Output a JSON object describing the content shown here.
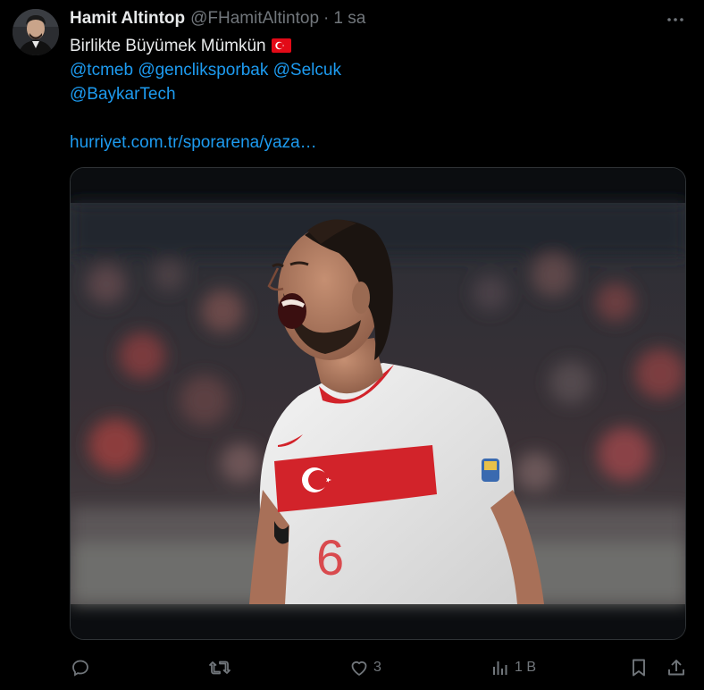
{
  "tweet": {
    "author_name": "Hamit Altintop",
    "handle": "@FHamitAltintop",
    "separator": "·",
    "time": "1 sa",
    "text_line1": "Birlikte Büyümek Mümkün",
    "mention1": "@tcmeb",
    "mention2": "@gencliksporbak",
    "mention3": "@Selcuk",
    "mention4": "@BaykarTech",
    "link": "hurriyet.com.tr/sporarena/yaza…",
    "flag_icon": "turkey-flag-emoji",
    "jersey_number": "6"
  },
  "actions": {
    "reply_icon": "reply-icon",
    "retweet_icon": "retweet-icon",
    "like_icon": "heart-icon",
    "like_count": "3",
    "views_icon": "views-chart-icon",
    "views_count": "1 B",
    "bookmark_icon": "bookmark-icon",
    "share_icon": "share-icon"
  },
  "colors": {
    "background": "#000000",
    "text": "#e7e9ea",
    "muted": "#71767b",
    "link": "#1d9bf0",
    "border": "#2f3336",
    "flag_red": "#e30a17"
  }
}
